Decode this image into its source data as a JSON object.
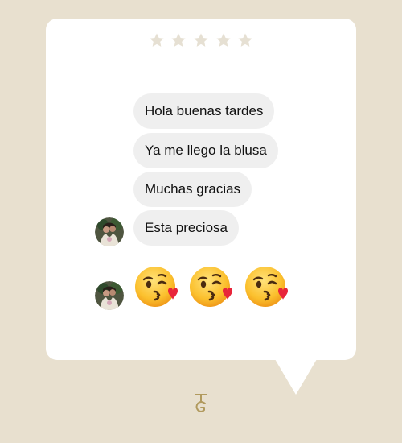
{
  "colors": {
    "background": "#e8e0cf",
    "card": "#ffffff",
    "bubble": "#efefef",
    "star": "#e6e0d3",
    "logo": "#b19a5e"
  },
  "rating": {
    "stars_total": 5,
    "stars_filled": 0
  },
  "chat": {
    "messages": [
      {
        "text": "Hola buenas tardes"
      },
      {
        "text": "Ya me llego la blusa"
      },
      {
        "text": "Muchas gracias"
      },
      {
        "text": "Esta preciosa"
      }
    ],
    "emoji_reactions": [
      "kissing-face-with-heart",
      "kissing-face-with-heart",
      "kissing-face-with-heart"
    ]
  },
  "brand": {
    "logo_icon": "tg-monogram-icon"
  }
}
